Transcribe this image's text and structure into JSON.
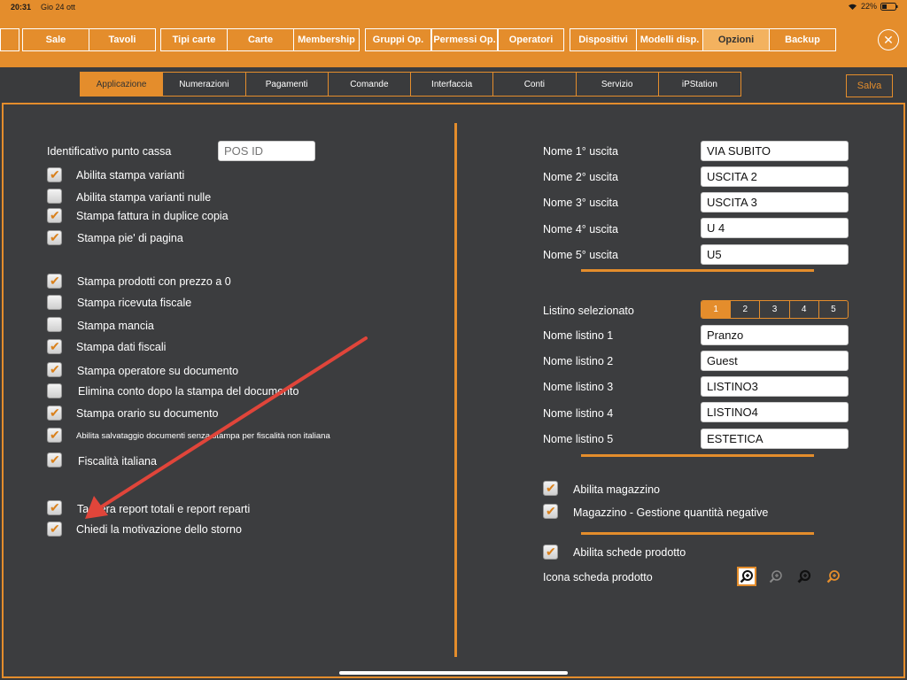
{
  "status": {
    "time": "20:31",
    "date": "Gio 24 ott",
    "battery": "22%"
  },
  "tabs": [
    "Sale",
    "Tavoli",
    "Tipi carte",
    "Carte",
    "Membership",
    "Gruppi Op.",
    "Permessi Op.",
    "Operatori",
    "Dispositivi",
    "Modelli disp.",
    "Opzioni",
    "Backup"
  ],
  "subtabs": [
    "Applicazione",
    "Numerazioni",
    "Pagamenti",
    "Comande",
    "Interfaccia",
    "Conti",
    "Servizio",
    "iPStation"
  ],
  "save_label": "Salva",
  "left": {
    "pos_label": "Identificativo punto cassa",
    "pos_placeholder": "POS ID",
    "options": [
      {
        "label": "Abilita stampa varianti",
        "checked": true
      },
      {
        "label": "Abilita stampa varianti nulle",
        "checked": false
      },
      {
        "label": "Stampa fattura in duplice copia",
        "checked": true
      },
      {
        "label": "Stampa pie' di pagina",
        "checked": true
      },
      {
        "label": "Stampa prodotti con prezzo a 0",
        "checked": true
      },
      {
        "label": "Stampa ricevuta fiscale",
        "checked": false
      },
      {
        "label": "Stampa mancia",
        "checked": false
      },
      {
        "label": "Stampa dati fiscali",
        "checked": true
      },
      {
        "label": "Stampa operatore su documento",
        "checked": true
      },
      {
        "label": "Elimina conto dopo la stampa del documento",
        "checked": false
      },
      {
        "label": "Stampa orario su documento",
        "checked": true
      },
      {
        "label": "Abilita salvataggio documenti senza stampa per fiscalità non italiana",
        "checked": true
      },
      {
        "label": "Fiscalità italiana",
        "checked": true
      },
      {
        "label": "Tastiera report totali e report reparti",
        "checked": true
      },
      {
        "label": "Chiedi la motivazione dello storno",
        "checked": true
      }
    ]
  },
  "right": {
    "exits": [
      {
        "label": "Nome 1° uscita",
        "value": " VIA SUBITO"
      },
      {
        "label": "Nome 2° uscita",
        "value": "USCITA 2"
      },
      {
        "label": "Nome 3° uscita",
        "value": "USCITA 3"
      },
      {
        "label": "Nome 4° uscita",
        "value": "U 4"
      },
      {
        "label": "Nome 5° uscita",
        "value": "U5"
      }
    ],
    "listino_label": "Listino selezionato",
    "listino_options": [
      "1",
      "2",
      "3",
      "4",
      "5"
    ],
    "listino_selected": "1",
    "listini": [
      {
        "label": "Nome listino 1",
        "value": "Pranzo"
      },
      {
        "label": "Nome listino 2",
        "value": "Guest"
      },
      {
        "label": "Nome listino 3",
        "value": "LISTINO3"
      },
      {
        "label": "Nome listino 4",
        "value": "LISTINO4"
      },
      {
        "label": "Nome listino 5",
        "value": "ESTETICA"
      }
    ],
    "magazzino": [
      {
        "label": "Abilita magazzino",
        "checked": true
      },
      {
        "label": "Magazzino - Gestione quantità negative",
        "checked": true
      }
    ],
    "schede": {
      "label": "Abilita schede prodotto",
      "checked": true
    },
    "icon_label": "Icona scheda prodotto"
  },
  "colors": {
    "accent": "#e48d2c",
    "background": "#3a3b3d"
  }
}
